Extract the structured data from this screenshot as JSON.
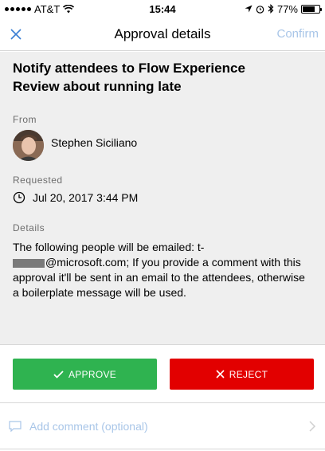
{
  "status_bar": {
    "carrier": "AT&T",
    "time": "15:44",
    "battery_percent": "77%",
    "battery_level": 0.77
  },
  "nav": {
    "title": "Approval details",
    "confirm_label": "Confirm",
    "close_icon": "close-icon"
  },
  "approval": {
    "title": "Notify attendees to Flow Experience Review about running late",
    "from_label": "From",
    "from_name": "Stephen Siciliano",
    "requested_label": "Requested",
    "requested_date": "Jul 20, 2017 3:44 PM",
    "details_label": "Details",
    "details_prefix": "The following people will be emailed: t-",
    "details_suffix": "@microsoft.com; If you provide a comment with this approval it'll be sent in an email to the attendees, otherwise a boilerplate message will be used."
  },
  "actions": {
    "approve_label": "APPROVE",
    "reject_label": "REJECT"
  },
  "comment": {
    "placeholder": "Add comment (optional)"
  },
  "colors": {
    "approve": "#2fb350",
    "reject": "#e20000",
    "accent_light": "#a9c6e8",
    "background": "#efefef"
  }
}
